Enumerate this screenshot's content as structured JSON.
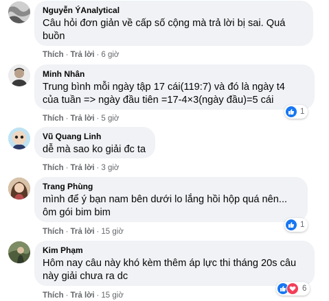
{
  "ui": {
    "like_label": "Thích",
    "reply_label": "Trả lời",
    "separator": "·"
  },
  "comments": [
    {
      "author": "Nguyễn ÝAnalytical",
      "lines": [
        "Câu hỏi đơn giản về cấp số cộng mà trả lời bị sai. Quá",
        "buồn"
      ],
      "time": "6 giờ",
      "reaction_count": null
    },
    {
      "author": "Minh Nhân",
      "lines": [
        "Trung bình mỗi ngày tập 17 cái(119:7) và đó là ngày t4",
        "của tuần => ngày đầu tiên =17-4×3(ngày đầu)=5 cái"
      ],
      "time": "5 giờ",
      "reaction_count": "1"
    },
    {
      "author": "Vũ Quang Linh",
      "lines": [
        "dễ mà sao ko giải đc ta"
      ],
      "time": "3 giờ",
      "reaction_count": null
    },
    {
      "author": "Trang Phùng",
      "lines": [
        "mình để ý bạn nam bên dưới lo lắng hồi hộp quá nên...",
        "ôm gói bim bim"
      ],
      "time": "15 giờ",
      "reaction_count": "1"
    },
    {
      "author": "Kim Phạm",
      "lines": [
        "Hôm nay câu này khó kèm thêm áp lực thi tháng 20s câu",
        "này giải chưa ra dc"
      ],
      "time": "15 giờ",
      "reaction_count": "6"
    }
  ],
  "colors": {
    "bubble": "#f0f2f5",
    "like": "#1877f2",
    "love": "#f33e58",
    "meta": "#65676b"
  }
}
